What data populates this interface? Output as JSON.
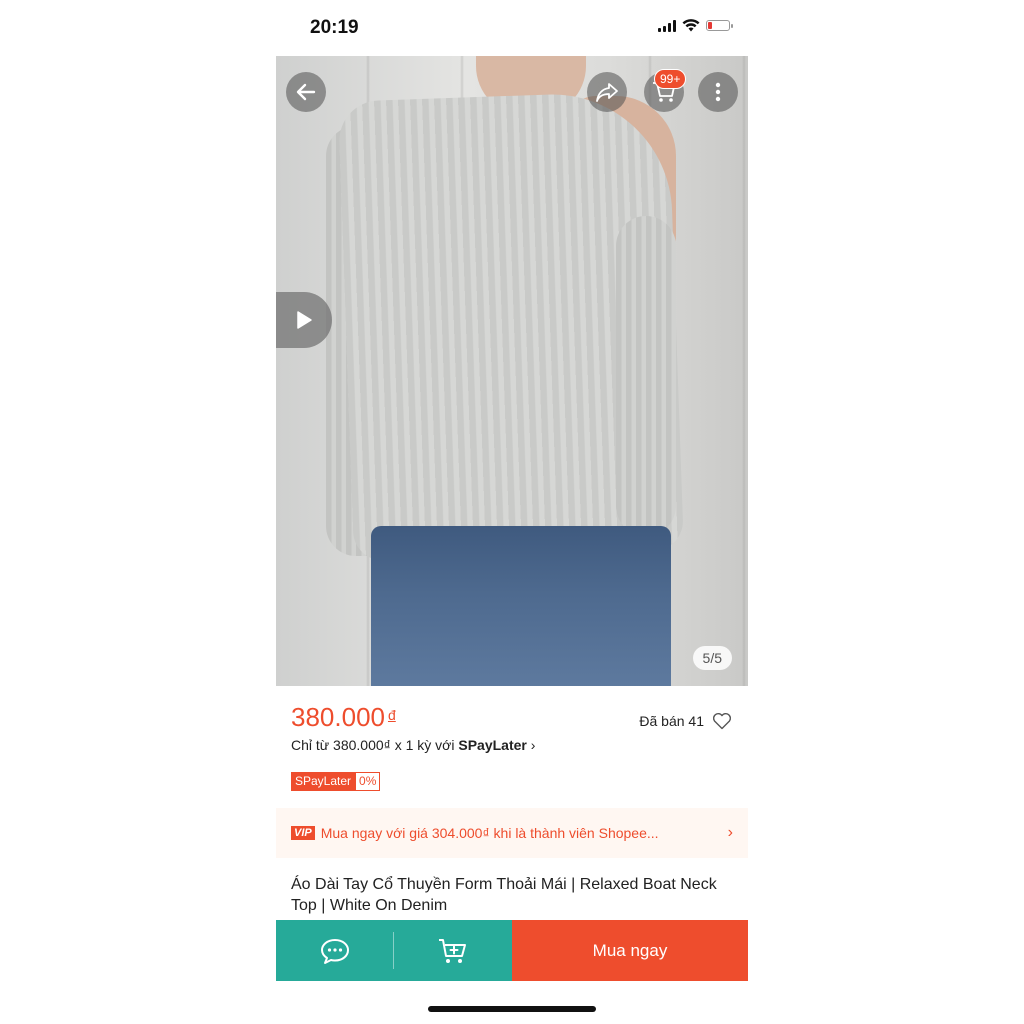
{
  "status_bar": {
    "time": "20:19",
    "battery_level": 0.2
  },
  "header": {
    "cart_badge": "99+"
  },
  "gallery": {
    "counter": "5/5"
  },
  "product": {
    "price": "380.000",
    "currency": "đ",
    "sold": "Đã bán 41",
    "installment_prefix": "Chỉ từ 380.000₫ x 1 kỳ với",
    "installment_brand": "SPayLater",
    "installment_chevron": "›",
    "tag_left": "SPayLater",
    "tag_right": "0%",
    "title": "Áo Dài Tay Cổ Thuyền Form Thoải Mái | Relaxed Boat Neck Top | White On Denim"
  },
  "vip": {
    "badge": "VIP",
    "text": "Mua ngay với giá 304.000₫ khi là thành viên Shopee...",
    "chevron": "›"
  },
  "bottom_bar": {
    "buy_now": "Mua ngay"
  },
  "colors": {
    "accent": "#ee4d2d",
    "teal": "#26aa99"
  },
  "icons": [
    "back-arrow-icon",
    "share-icon",
    "cart-icon",
    "more-icon",
    "play-icon",
    "heart-icon",
    "chat-icon",
    "add-to-cart-icon"
  ]
}
